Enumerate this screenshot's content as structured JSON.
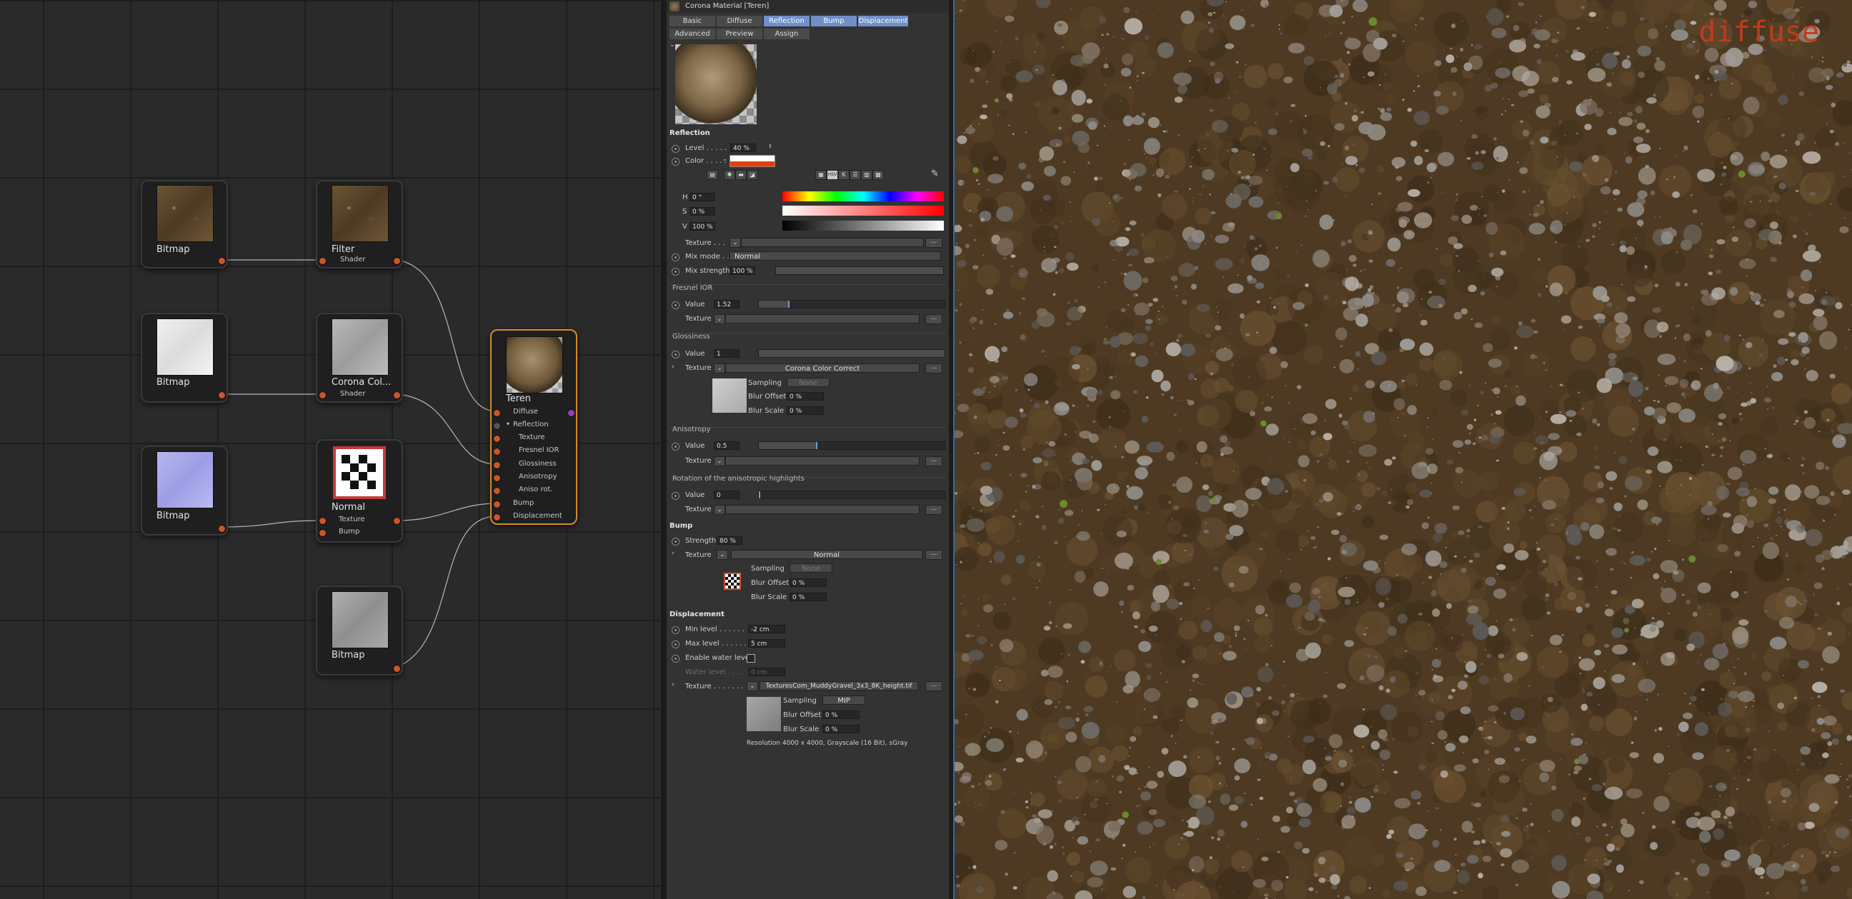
{
  "node_editor": {
    "nodes": {
      "bitmap_1": {
        "title": "Bitmap"
      },
      "bitmap_2": {
        "title": "Bitmap"
      },
      "bitmap_3": {
        "title": "Bitmap"
      },
      "bitmap_4": {
        "title": "Bitmap"
      },
      "filter": {
        "title": "Filter",
        "port": "Shader"
      },
      "corona_col": {
        "title": "Corona Col...",
        "port": "Shader"
      },
      "normal": {
        "title": "Normal",
        "ports": [
          "Texture",
          "Bump"
        ]
      },
      "teren": {
        "title": "Teren",
        "ports": [
          "Diffuse",
          "Reflection",
          "Texture",
          "Fresnel IOR",
          "Glossiness",
          "Anisotropy",
          "Aniso rot.",
          "Bump",
          "Displacement"
        ]
      }
    }
  },
  "attributes": {
    "header": "Corona Material [Teren]",
    "tabs_row1": [
      "Basic",
      "Diffuse",
      "Reflection",
      "Bump",
      "Displacement"
    ],
    "tabs_row2": [
      "Advanced",
      "Preview",
      "Assign"
    ],
    "active_tabs": [
      "Reflection",
      "Bump",
      "Displacement"
    ],
    "reflection": {
      "title": "Reflection",
      "level_label": "Level . . . . .",
      "level_value": "40 %",
      "level_fraction": 0.4,
      "color_label": "Color . . . . .",
      "color_hex": "#e1400a",
      "h_label": "H",
      "h_value": "0 °",
      "s_label": "S",
      "s_value": "0 %",
      "v_label": "V",
      "v_value": "100 %",
      "texture_label": "Texture . . .",
      "mixmode_label": "Mix mode . .",
      "mixmode_value": "Normal",
      "mixstrength_label": "Mix strength",
      "mixstrength_value": "100 %",
      "mixstrength_fraction": 1.0,
      "tool_button": "HSV"
    },
    "fresnel": {
      "title": "Fresnel IOR",
      "value_label": "Value",
      "value": "1.52",
      "texture_label": "Texture"
    },
    "glossiness": {
      "title": "Glossiness",
      "value_label": "Value",
      "value": "1",
      "texture_label": "Texture",
      "texture_value": "Corona Color Correct",
      "sampling_label": "Sampling",
      "sampling_value": "None",
      "bluroffset_label": "Blur Offset",
      "bluroffset_value": "0 %",
      "blurscale_label": "Blur Scale",
      "blurscale_value": "0 %"
    },
    "anisotropy": {
      "title": "Anisotropy",
      "value_label": "Value",
      "value": "0.5",
      "value_fraction": 0.5,
      "texture_label": "Texture"
    },
    "rotation": {
      "title": "Rotation of the anisotropic highlights",
      "value_label": "Value",
      "value": "0",
      "texture_label": "Texture"
    },
    "bump": {
      "title": "Bump",
      "strength_label": "Strength",
      "strength_value": "80 %",
      "texture_label": "Texture",
      "texture_value": "Normal",
      "sampling_label": "Sampling",
      "sampling_value": "None",
      "bluroffset_label": "Blur Offset",
      "bluroffset_value": "0 %",
      "blurscale_label": "Blur Scale",
      "blurscale_value": "0 %"
    },
    "displacement": {
      "title": "Displacement",
      "min_label": "Min level . . . . . .",
      "min_value": "-2 cm",
      "max_label": "Max level . . . . . .",
      "max_value": "5 cm",
      "water_enable_label": "Enable water level",
      "water_level_label": "Water level . . . . .",
      "water_level_value": "0 cm",
      "texture_label": "Texture . . . . . . .",
      "texture_value": "TexturesCom_MuddyGravel_3x3_8K_height.tif",
      "sampling_label": "Sampling",
      "sampling_value": "MIP",
      "bluroffset_label": "Blur Offset",
      "bluroffset_value": "0 %",
      "blurscale_label": "Blur Scale",
      "blurscale_value": "0 %",
      "resolution": "Resolution 4000 x 4000, Grayscale (16 Bit), sGray"
    },
    "dots_label": "..."
  },
  "texture_view": {
    "label": "diffuse"
  },
  "colors": {
    "port": "#c9552d",
    "active_tab": "#6f8fc8",
    "label_red": "#c23a1e"
  }
}
